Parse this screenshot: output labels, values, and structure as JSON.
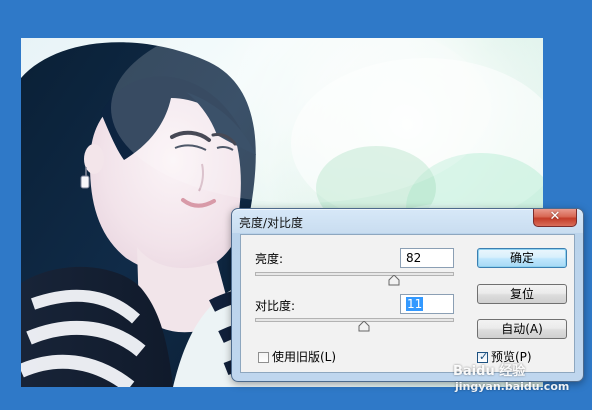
{
  "dialog": {
    "title": "亮度/对比度",
    "close_label": "✕",
    "brightness": {
      "label": "亮度:",
      "value": "82",
      "slider_fraction": 0.71
    },
    "contrast": {
      "label": "对比度:",
      "value": "11",
      "slider_fraction": 0.55
    },
    "buttons": {
      "ok": "确定",
      "reset": "复位",
      "auto": "自动(A)"
    },
    "legacy_checkbox": {
      "label": "使用旧版(L)",
      "checked": false
    },
    "preview_checkbox": {
      "label": "预览(P)",
      "checked": true
    }
  },
  "watermark": {
    "brand": "Baidu 经验",
    "site": "jingyan.baidu.com"
  },
  "icons": {
    "close": "close-icon",
    "slider_thumb": "triangle-thumb-icon",
    "check": "checkmark-icon"
  },
  "colors": {
    "desktop_bg": "#2f79c8",
    "selection": "#3399ff",
    "close_button": "#c43d29"
  }
}
